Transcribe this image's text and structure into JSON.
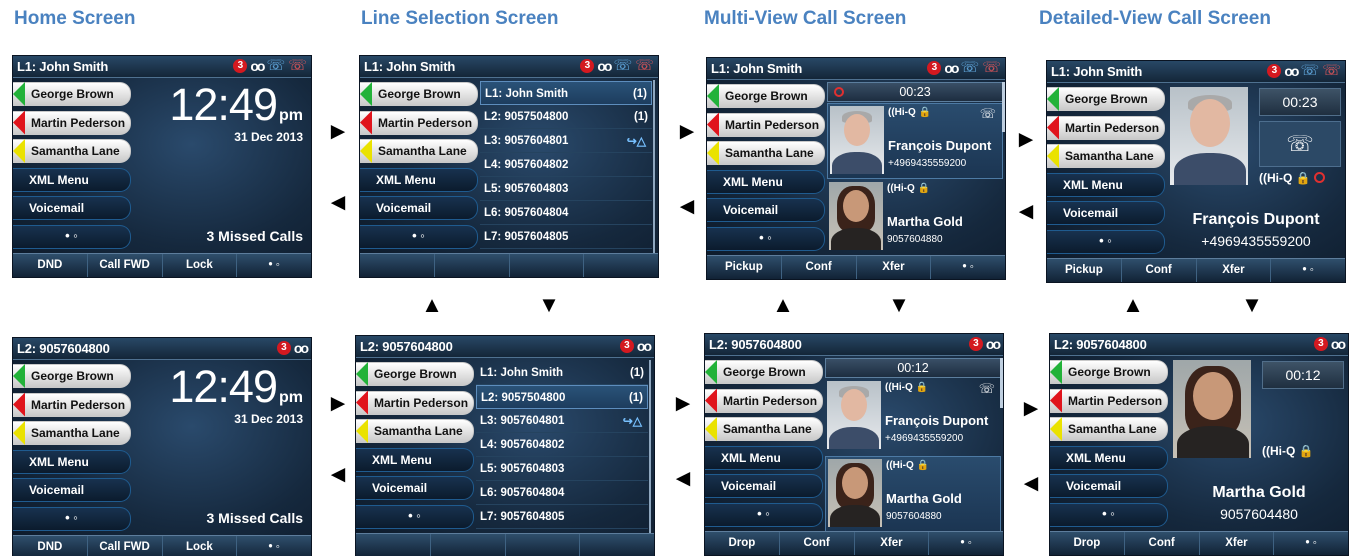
{
  "titles": {
    "home": "Home Screen",
    "line": "Line Selection Screen",
    "multi": "Multi-View Call Screen",
    "detail": "Detailed-View Call Screen"
  },
  "keys": {
    "george": "George Brown",
    "martin": "Martin Pederson",
    "samantha": "Samantha Lane",
    "xml": "XML Menu",
    "voicemail": "Voicemail",
    "more": "• ◦"
  },
  "indicators": {
    "missed_count": "3",
    "voicemail_glyph": "oo"
  },
  "home": {
    "time": "12:49",
    "ampm": "pm",
    "date": "31 Dec 2013",
    "missed": "3 Missed Calls"
  },
  "softkeys_home": [
    "DND",
    "Call FWD",
    "Lock",
    "• ◦"
  ],
  "softkeys_call_top": [
    "Pickup",
    "Conf",
    "Xfer",
    "• ◦"
  ],
  "softkeys_call_bottom": [
    "Drop",
    "Conf",
    "Xfer",
    "• ◦"
  ],
  "lines": {
    "l1": "L1: John Smith",
    "l2": "L2: 9057504800",
    "l3": "L3: 9057604801",
    "l4": "L4: 9057604802",
    "l5": "L5: 9057604803",
    "l6": "L6: 9057604804",
    "l7": "L7: 9057604805",
    "cnt1": "(1)",
    "cnt2": "(1)"
  },
  "headers": {
    "top": "L1: John Smith",
    "bottom": "L2: 9057604800"
  },
  "calls": {
    "timer_top": "00:23",
    "timer_bottom": "00:12",
    "hiq": "((Hi-Q",
    "lock": "🔒",
    "francois_name": "François Dupont",
    "francois_num": "+4969435559200",
    "martha_name": "Martha Gold",
    "martha_num_small": "9057604880",
    "martha_num_large": "9057604480"
  },
  "arrows": {
    "right": "►",
    "left": "◄",
    "up": "▲",
    "down": "▼"
  },
  "colors": {
    "title": "#4a82c0",
    "green": "#22b239",
    "red": "#e0141c",
    "yellow": "#eae200"
  }
}
